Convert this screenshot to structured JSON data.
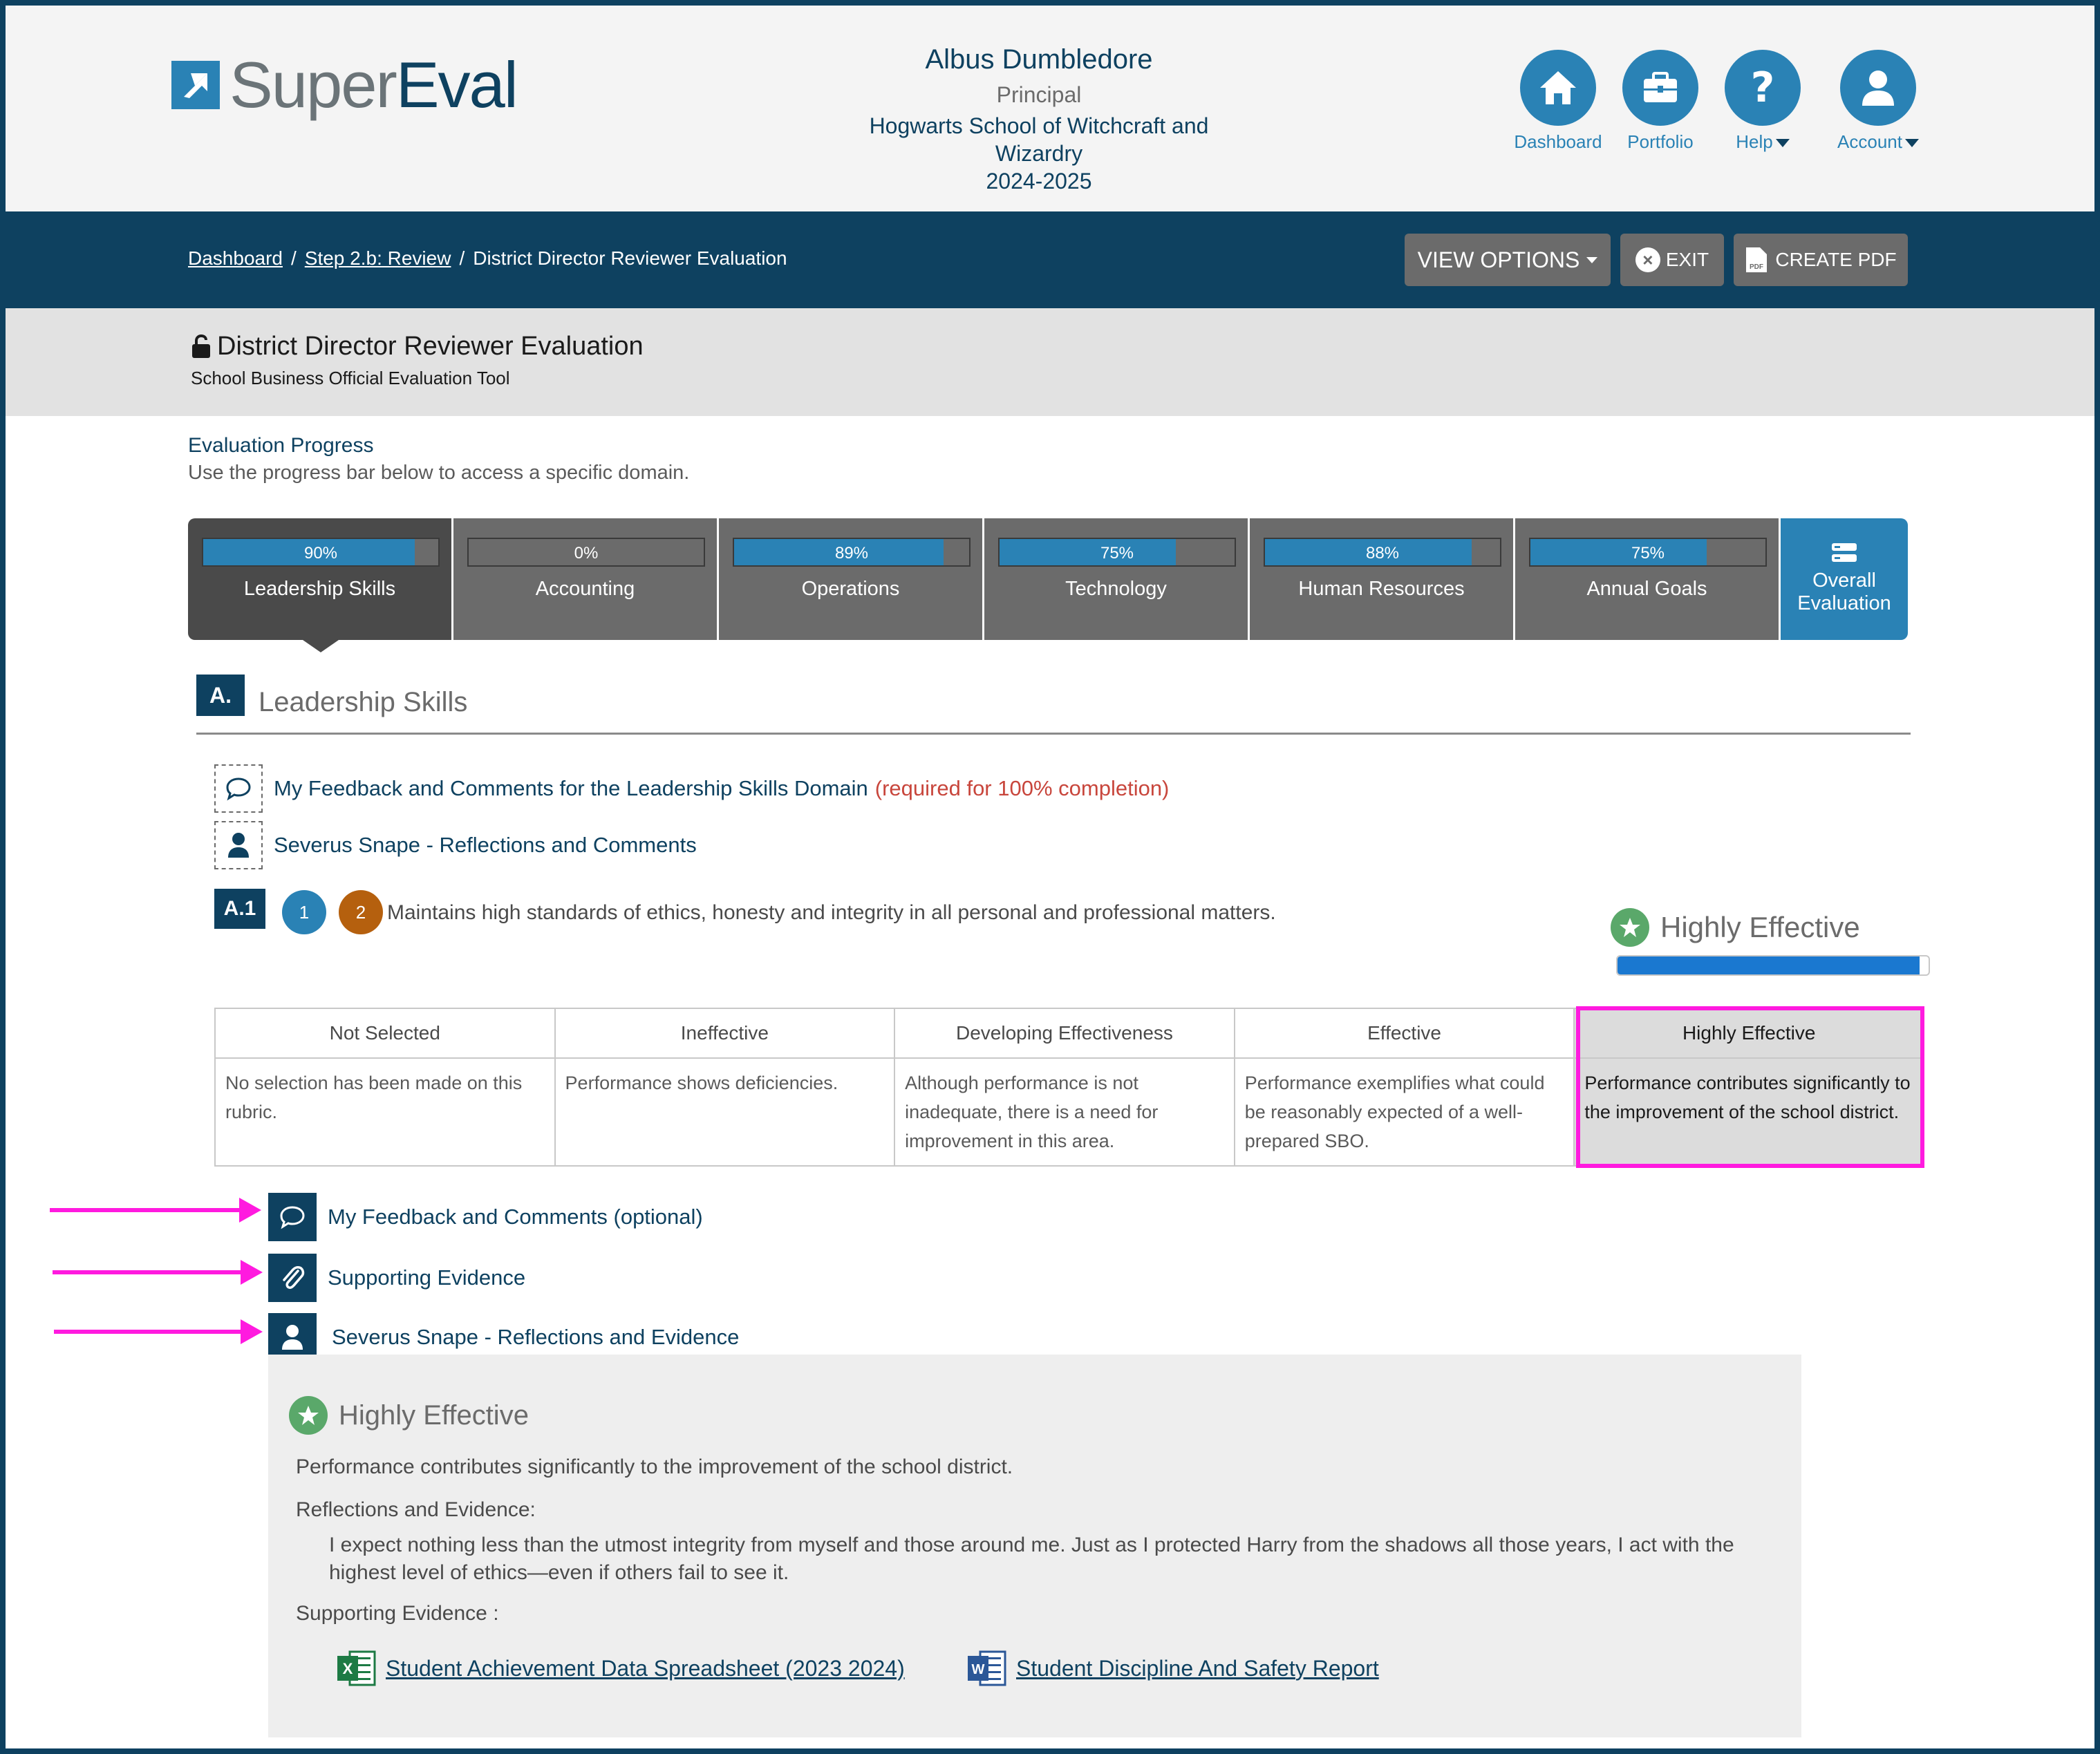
{
  "app": {
    "logo_text_light": "Super",
    "logo_text_dark": "Eval",
    "logo_mark": "tm"
  },
  "user": {
    "name": "Albus Dumbledore",
    "role": "Principal",
    "school_line1": "Hogwarts School of Witchcraft and",
    "school_line2": "Wizardry",
    "year": "2024-2025"
  },
  "top_nav": {
    "dashboard": "Dashboard",
    "portfolio": "Portfolio",
    "help": "Help",
    "account": "Account"
  },
  "breadcrumb": {
    "items": [
      "Dashboard",
      "Step 2.b: Review",
      "District Director Reviewer Evaluation"
    ],
    "separator": "/"
  },
  "toolbar": {
    "view_options": "VIEW OPTIONS",
    "exit": "EXIT",
    "exit_icon": "×",
    "create_pdf": "CREATE PDF"
  },
  "evaluation": {
    "title": "District Director Reviewer Evaluation",
    "subtitle": "School Business Official Evaluation Tool"
  },
  "progress": {
    "title": "Evaluation Progress",
    "help": "Use the progress bar below to access a specific domain.",
    "domains": [
      {
        "name": "Leadership Skills",
        "percent_label": "90%",
        "percent": 90
      },
      {
        "name": "Accounting",
        "percent_label": "0%",
        "percent": 0
      },
      {
        "name": "Operations",
        "percent_label": "89%",
        "percent": 89
      },
      {
        "name": "Technology",
        "percent_label": "75%",
        "percent": 75
      },
      {
        "name": "Human Resources",
        "percent_label": "88%",
        "percent": 88
      },
      {
        "name": "Annual Goals",
        "percent_label": "75%",
        "percent": 75
      }
    ],
    "overall_line1": "Overall",
    "overall_line2": "Evaluation"
  },
  "domain_section": {
    "letter": "A.",
    "heading": "Leadership Skills",
    "feedback_link": "My Feedback and Comments for the Leadership Skills Domain",
    "feedback_required": "(required for 100% completion)",
    "reflections_link": "Severus Snape - Reflections and Comments"
  },
  "criterion": {
    "tag": "A.1",
    "num1": "1",
    "num2": "2",
    "text": "Maintains high standards of ethics, honesty and integrity in all personal and professional matters.",
    "rating": "Highly Effective",
    "rating_level": 0.97
  },
  "rubric": {
    "headers": [
      "Not Selected",
      "Ineffective",
      "Developing Effectiveness",
      "Effective",
      "Highly Effective"
    ],
    "descriptions": [
      "No selection has been made on this rubric.",
      "Performance shows deficiencies.",
      "Although performance is not inadequate, there is a need for improvement in this area.",
      "Performance exemplifies what could be reasonably expected of a well-prepared SBO.",
      "Performance contributes significantly to the improvement of the school district."
    ],
    "selected_index": 4
  },
  "bottom_links": {
    "feedback": "My Feedback and Comments (optional)",
    "evidence": "Supporting Evidence",
    "reflections": "Severus Snape - Reflections and Evidence"
  },
  "panel": {
    "rating": "Highly Effective",
    "description": "Performance contributes significantly to the improvement of the school district.",
    "reflections_label": "Reflections and Evidence:",
    "reflections_text": "I expect nothing less than the utmost integrity from myself and those around me. Just as I protected Harry from the shadows all those years, I act with the highest level of ethics—even if others fail to see it.",
    "evidence_label": "Supporting Evidence :",
    "files": [
      {
        "name": "Student Achievement Data Spreadsheet (2023 2024)",
        "icon": "excel-file-icon",
        "icon_letter": "X"
      },
      {
        "name": "Student Discipline And Safety Report",
        "icon": "word-file-icon",
        "icon_letter": "W"
      }
    ]
  },
  "colors": {
    "navy": "#0e4160",
    "blue": "#2a82b5",
    "gray": "#6b6b6b",
    "highlight": "#ff1adf",
    "required": "#c8463c",
    "star_green": "#5aa86a"
  }
}
